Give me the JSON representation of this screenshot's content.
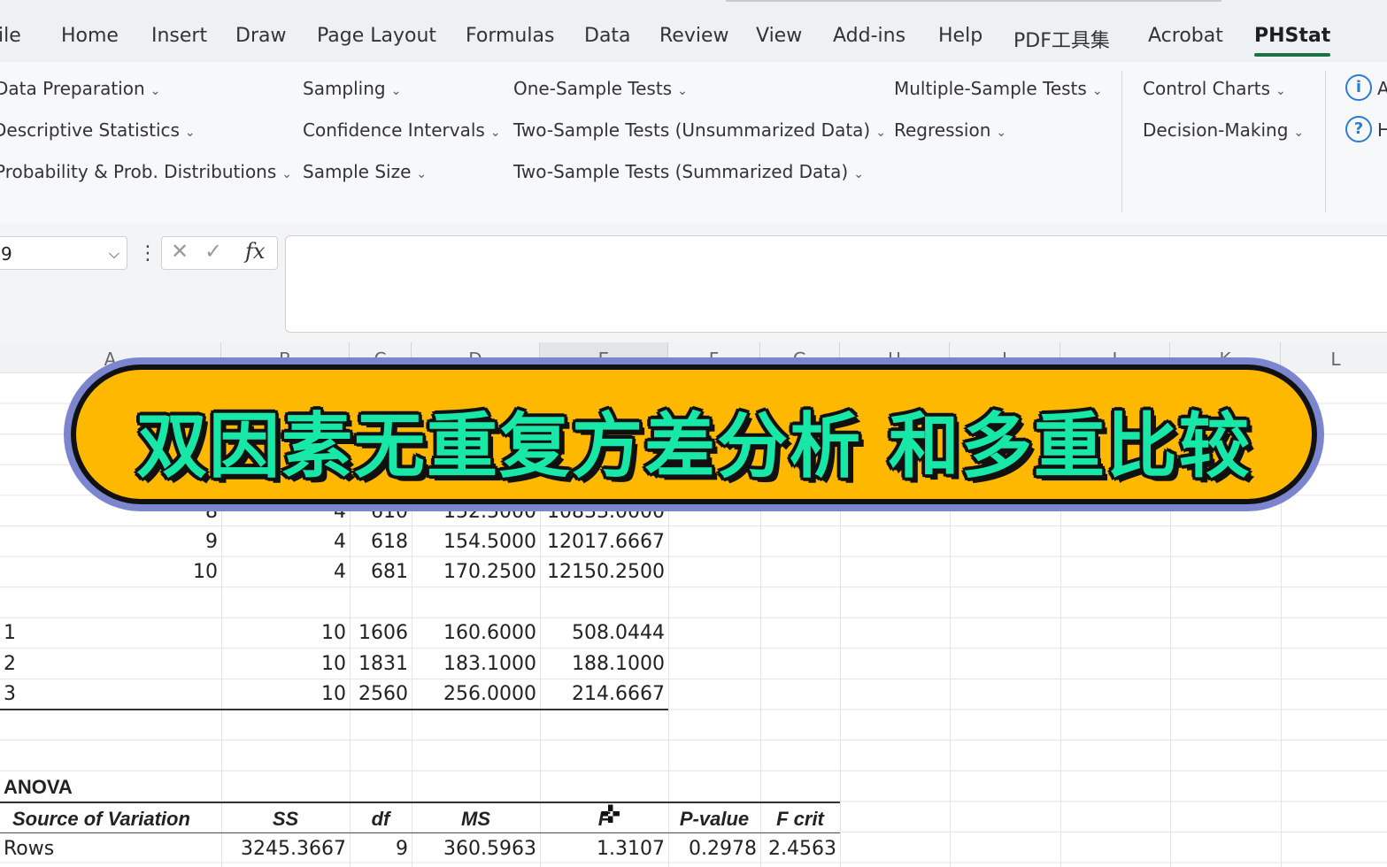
{
  "ribbon_tabs": [
    "ile",
    "Home",
    "Insert",
    "Draw",
    "Page Layout",
    "Formulas",
    "Data",
    "Review",
    "View",
    "Add-ins",
    "Help",
    "PDF工具集",
    "Acrobat",
    "PHStat"
  ],
  "active_tab": "PHStat",
  "phstat": {
    "col1": [
      "Data Preparation",
      "Descriptive Statistics",
      "Probability & Prob. Distributions"
    ],
    "col2": [
      "Sampling",
      "Confidence Intervals",
      "Sample Size"
    ],
    "col3": [
      "One-Sample Tests",
      "Two-Sample Tests (Unsummarized Data)",
      "Two-Sample Tests (Summarized Data)"
    ],
    "col4": [
      "Multiple-Sample Tests",
      "Regression"
    ],
    "col5": [
      "Control Charts",
      "Decision-Making"
    ],
    "col6": [
      "A",
      "H"
    ],
    "info_icon": "info-icon",
    "help_icon": "help-icon"
  },
  "formula_bar": {
    "name_box": "9",
    "cancel_icon": "cancel-icon",
    "enter_icon": "check-icon",
    "fx": "fx",
    "value": ""
  },
  "columns": [
    "A",
    "B",
    "C",
    "D",
    "E",
    "F",
    "G",
    "H",
    "I",
    "J",
    "K",
    "L"
  ],
  "banner_title": "双因素无重复方差分析  和多重比较",
  "rows_summary": [
    {
      "label": "8",
      "count": "4",
      "sum": "610",
      "avg": "152.5000",
      "var": "10833.0000"
    },
    {
      "label": "9",
      "count": "4",
      "sum": "618",
      "avg": "154.5000",
      "var": "12017.6667"
    },
    {
      "label": "10",
      "count": "4",
      "sum": "681",
      "avg": "170.2500",
      "var": "12150.2500"
    }
  ],
  "cols_summary": [
    {
      "label": "1",
      "count": "10",
      "sum": "1606",
      "avg": "160.6000",
      "var": "508.0444"
    },
    {
      "label": "2",
      "count": "10",
      "sum": "1831",
      "avg": "183.1000",
      "var": "188.1000"
    },
    {
      "label": "3",
      "count": "10",
      "sum": "2560",
      "avg": "256.0000",
      "var": "214.6667"
    }
  ],
  "anova": {
    "title": "ANOVA",
    "headers": [
      "Source of Variation",
      "SS",
      "df",
      "MS",
      "F",
      "P-value",
      "F crit"
    ],
    "rows": [
      [
        "Rows",
        "3245.3667",
        "9",
        "360.5963",
        "1.3107",
        "0.2978",
        "2.4563"
      ]
    ]
  }
}
